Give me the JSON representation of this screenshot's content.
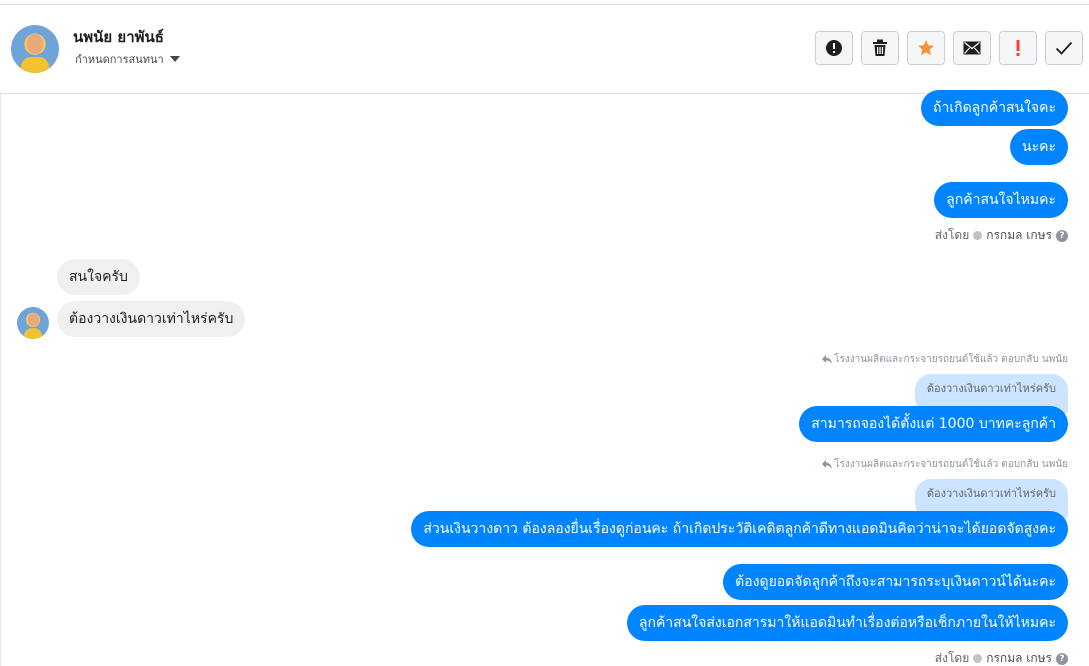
{
  "header": {
    "contact_name": "นพนัย ยาพันธ์",
    "assign_label": "กำหนดการสนทนา"
  },
  "actions": [
    {
      "icon": "alert-circle-icon",
      "color": "#1c1e21"
    },
    {
      "icon": "trash-icon",
      "color": "#1c1e21"
    },
    {
      "icon": "star-icon",
      "color": "#f7923a"
    },
    {
      "icon": "envelope-icon",
      "color": "#1c1e21"
    },
    {
      "icon": "exclamation-icon",
      "color": "#fa3e3e"
    },
    {
      "icon": "check-icon",
      "color": "#1c1e21"
    }
  ],
  "colors": {
    "outgoing_bubble": "#0084ff",
    "incoming_bubble": "#f0f0f0",
    "reply_quote": "#cce4ff"
  },
  "messages": {
    "out1": "ถ้าเกิดลูกค้าสนใจคะ",
    "out2": "นะคะ",
    "out3": "ลูกค้าสนใจไหมคะ",
    "sent_by_1": {
      "prefix": "ส่งโดย",
      "agent": "กรกมล เกษร"
    },
    "in1": "สนใจครับ",
    "in2": "ต้องวางเงินดาวเท่าไหร่ครับ",
    "reply1": {
      "meta": "โรงงานผลิตและกระจายรถยนต์ใช้แล้ว ตอบกลับ นพนัย",
      "quote": "ต้องวางเงินดาวเท่าไหร่ครับ",
      "text": "สามารถจองได้ตั้งแต่ 1000 บาทคะลูกค้า"
    },
    "reply2": {
      "meta": "โรงงานผลิตและกระจายรถยนต์ใช้แล้ว ตอบกลับ นพนัย",
      "quote": "ต้องวางเงินดาวเท่าไหร่ครับ",
      "text": "ส่วนเงินวางดาว ต้องลองยื่นเรื่องดูก่อนคะ ถ้าเกิดประวัติเคดิตลูกค้าดีทางแอดมินคิดว่าน่าจะได้ยอดจัดสูงคะ"
    },
    "out4": "ต้องดูยอดจัดลูกค้าถึงจะสามารถระบุเงินดาวน์ได้นะคะ",
    "out5": "ลูกค้าสนใจส่งเอกสารมาให้แอดมินทำเรื่องต่อหรือเช็กภายในให้ไหมคะ",
    "sent_by_2": {
      "prefix": "ส่งโดย",
      "agent": "กรกมล เกษร"
    }
  }
}
